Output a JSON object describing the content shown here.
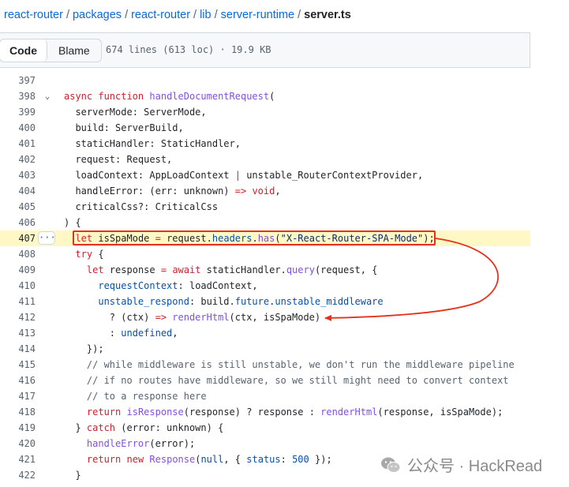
{
  "breadcrumb": {
    "parts": [
      "react-router",
      "packages",
      "react-router",
      "lib",
      "server-runtime"
    ],
    "separator": "/",
    "current": "server.ts"
  },
  "toolbar": {
    "code_label": "Code",
    "blame_label": "Blame",
    "file_info": "674 lines (613 loc) · 19.9 KB"
  },
  "code": {
    "lines": [
      {
        "num": "397",
        "html": ""
      },
      {
        "num": "398",
        "html": "<span class=\"k\">async</span> <span class=\"k\">function</span> <span class=\"f\">handleDocumentRequest</span>(",
        "fold": "⌄"
      },
      {
        "num": "399",
        "html": "  serverMode: ServerMode,"
      },
      {
        "num": "400",
        "html": "  build: ServerBuild,"
      },
      {
        "num": "401",
        "html": "  staticHandler: StaticHandler,"
      },
      {
        "num": "402",
        "html": "  request: Request,"
      },
      {
        "num": "403",
        "html": "  loadContext: AppLoadContext <span class=\"k\">|</span> unstable_RouterContextProvider,"
      },
      {
        "num": "404",
        "html": "  handleError: (err: unknown) <span class=\"k\">=&gt;</span> <span class=\"k\">void</span>,"
      },
      {
        "num": "405",
        "html": "  criticalCss?: CriticalCss"
      },
      {
        "num": "406",
        "html": ") {"
      },
      {
        "num": "407",
        "html": "  <span class=\"k\">let</span> isSpaMode <span class=\"k\">=</span> request.<span class=\"p\">headers</span>.<span class=\"f\">has</span>(<span class=\"s\">\"X-React-Router-SPA-Mode\"</span>);",
        "highlight": true
      },
      {
        "num": "408",
        "html": "  <span class=\"k\">try</span> {"
      },
      {
        "num": "409",
        "html": "    <span class=\"k\">let</span> response <span class=\"k\">=</span> <span class=\"k\">await</span> staticHandler.<span class=\"f\">query</span>(request, {"
      },
      {
        "num": "410",
        "html": "      <span class=\"p\">requestContext</span>: loadContext,"
      },
      {
        "num": "411",
        "html": "      <span class=\"p\">unstable_respond</span>: build.<span class=\"p\">future</span>.<span class=\"p\">unstable_middleware</span>"
      },
      {
        "num": "412",
        "html": "        ? (ctx) <span class=\"k\">=&gt;</span> <span class=\"f\">renderHtml</span>(ctx, isSpaMode)"
      },
      {
        "num": "413",
        "html": "        : <span class=\"p\">undefined</span>,"
      },
      {
        "num": "414",
        "html": "    });"
      },
      {
        "num": "415",
        "html": "    <span class=\"c\">// while middleware is still unstable, we don't run the middleware pipeline</span>"
      },
      {
        "num": "416",
        "html": "    <span class=\"c\">// if no routes have middleware, so we still might need to convert context</span>"
      },
      {
        "num": "417",
        "html": "    <span class=\"c\">// to a response here</span>"
      },
      {
        "num": "418",
        "html": "    <span class=\"k\">return</span> <span class=\"f\">isResponse</span>(response) ? response : <span class=\"f\">renderHtml</span>(response, isSpaMode);"
      },
      {
        "num": "419",
        "html": "  } <span class=\"k\">catch</span> (error: unknown) {"
      },
      {
        "num": "420",
        "html": "    <span class=\"f\">handleError</span>(error);"
      },
      {
        "num": "421",
        "html": "    <span class=\"k\">return</span> <span class=\"k\">new</span> <span class=\"f\">Response</span>(<span class=\"p\">null</span>, { <span class=\"p\">status</span>: <span class=\"p\">500</span> });"
      },
      {
        "num": "422",
        "html": "  }"
      }
    ],
    "more_icon": "kebab-horizontal-icon"
  },
  "annotation": {
    "color": "#e5331b"
  },
  "watermark": {
    "text": "公众号 · HackRead",
    "icon": "wechat-icon"
  }
}
